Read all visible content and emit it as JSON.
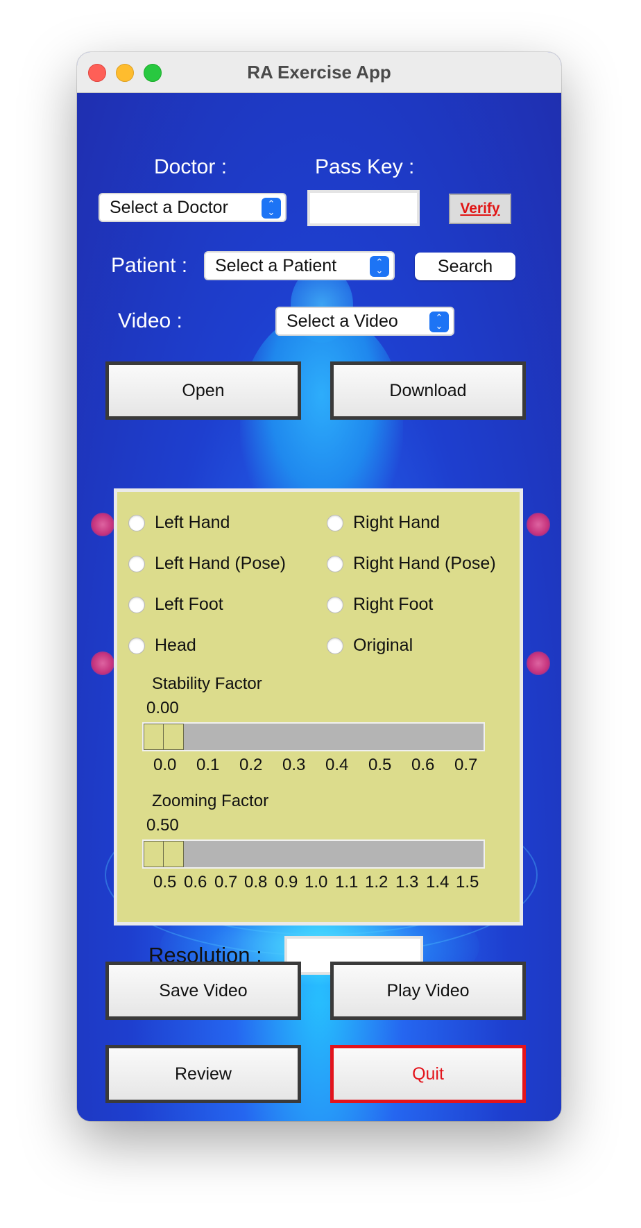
{
  "window": {
    "title": "RA Exercise App"
  },
  "doctor": {
    "label": "Doctor :",
    "select_value": "Select a Doctor"
  },
  "pass_key": {
    "label": "Pass Key :",
    "value": ""
  },
  "verify_label": "Verify",
  "patient": {
    "label": "Patient :",
    "select_value": "Select a Patient"
  },
  "search_label": "Search",
  "video": {
    "label": "Video :",
    "select_value": "Select a Video"
  },
  "buttons": {
    "open": "Open",
    "download": "Download",
    "save_video": "Save Video",
    "play_video": "Play Video",
    "review": "Review",
    "quit": "Quit"
  },
  "options": {
    "left_hand": "Left Hand",
    "right_hand": "Right Hand",
    "left_hand_pose": "Left Hand (Pose)",
    "right_hand_pose": "Right Hand (Pose)",
    "left_foot": "Left Foot",
    "right_foot": "Right Foot",
    "head": "Head",
    "original": "Original"
  },
  "stability": {
    "label": "Stability Factor",
    "value": "0.00",
    "ticks": [
      "0.0",
      "0.1",
      "0.2",
      "0.3",
      "0.4",
      "0.5",
      "0.6",
      "0.7"
    ]
  },
  "zooming": {
    "label": "Zooming Factor",
    "value": "0.50",
    "ticks": [
      "0.5",
      "0.6",
      "0.7",
      "0.8",
      "0.9",
      "1.0",
      "1.1",
      "1.2",
      "1.3",
      "1.4",
      "1.5"
    ]
  },
  "resolution": {
    "label": "Resolution :",
    "value": ""
  },
  "colors": {
    "accent_blue": "#1d74f5",
    "quit_red": "#e3141c",
    "panel": "#dcdc8c"
  }
}
